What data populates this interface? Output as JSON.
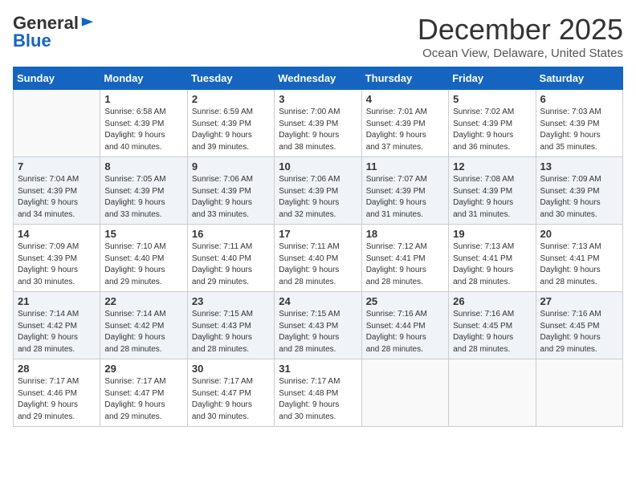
{
  "logo": {
    "general": "General",
    "blue": "Blue"
  },
  "title": "December 2025",
  "location": "Ocean View, Delaware, United States",
  "days_of_week": [
    "Sunday",
    "Monday",
    "Tuesday",
    "Wednesday",
    "Thursday",
    "Friday",
    "Saturday"
  ],
  "weeks": [
    [
      {
        "day": "",
        "info": ""
      },
      {
        "day": "1",
        "info": "Sunrise: 6:58 AM\nSunset: 4:39 PM\nDaylight: 9 hours\nand 40 minutes."
      },
      {
        "day": "2",
        "info": "Sunrise: 6:59 AM\nSunset: 4:39 PM\nDaylight: 9 hours\nand 39 minutes."
      },
      {
        "day": "3",
        "info": "Sunrise: 7:00 AM\nSunset: 4:39 PM\nDaylight: 9 hours\nand 38 minutes."
      },
      {
        "day": "4",
        "info": "Sunrise: 7:01 AM\nSunset: 4:39 PM\nDaylight: 9 hours\nand 37 minutes."
      },
      {
        "day": "5",
        "info": "Sunrise: 7:02 AM\nSunset: 4:39 PM\nDaylight: 9 hours\nand 36 minutes."
      },
      {
        "day": "6",
        "info": "Sunrise: 7:03 AM\nSunset: 4:39 PM\nDaylight: 9 hours\nand 35 minutes."
      }
    ],
    [
      {
        "day": "7",
        "info": "Sunrise: 7:04 AM\nSunset: 4:39 PM\nDaylight: 9 hours\nand 34 minutes."
      },
      {
        "day": "8",
        "info": "Sunrise: 7:05 AM\nSunset: 4:39 PM\nDaylight: 9 hours\nand 33 minutes."
      },
      {
        "day": "9",
        "info": "Sunrise: 7:06 AM\nSunset: 4:39 PM\nDaylight: 9 hours\nand 33 minutes."
      },
      {
        "day": "10",
        "info": "Sunrise: 7:06 AM\nSunset: 4:39 PM\nDaylight: 9 hours\nand 32 minutes."
      },
      {
        "day": "11",
        "info": "Sunrise: 7:07 AM\nSunset: 4:39 PM\nDaylight: 9 hours\nand 31 minutes."
      },
      {
        "day": "12",
        "info": "Sunrise: 7:08 AM\nSunset: 4:39 PM\nDaylight: 9 hours\nand 31 minutes."
      },
      {
        "day": "13",
        "info": "Sunrise: 7:09 AM\nSunset: 4:39 PM\nDaylight: 9 hours\nand 30 minutes."
      }
    ],
    [
      {
        "day": "14",
        "info": "Sunrise: 7:09 AM\nSunset: 4:39 PM\nDaylight: 9 hours\nand 30 minutes."
      },
      {
        "day": "15",
        "info": "Sunrise: 7:10 AM\nSunset: 4:40 PM\nDaylight: 9 hours\nand 29 minutes."
      },
      {
        "day": "16",
        "info": "Sunrise: 7:11 AM\nSunset: 4:40 PM\nDaylight: 9 hours\nand 29 minutes."
      },
      {
        "day": "17",
        "info": "Sunrise: 7:11 AM\nSunset: 4:40 PM\nDaylight: 9 hours\nand 28 minutes."
      },
      {
        "day": "18",
        "info": "Sunrise: 7:12 AM\nSunset: 4:41 PM\nDaylight: 9 hours\nand 28 minutes."
      },
      {
        "day": "19",
        "info": "Sunrise: 7:13 AM\nSunset: 4:41 PM\nDaylight: 9 hours\nand 28 minutes."
      },
      {
        "day": "20",
        "info": "Sunrise: 7:13 AM\nSunset: 4:41 PM\nDaylight: 9 hours\nand 28 minutes."
      }
    ],
    [
      {
        "day": "21",
        "info": "Sunrise: 7:14 AM\nSunset: 4:42 PM\nDaylight: 9 hours\nand 28 minutes."
      },
      {
        "day": "22",
        "info": "Sunrise: 7:14 AM\nSunset: 4:42 PM\nDaylight: 9 hours\nand 28 minutes."
      },
      {
        "day": "23",
        "info": "Sunrise: 7:15 AM\nSunset: 4:43 PM\nDaylight: 9 hours\nand 28 minutes."
      },
      {
        "day": "24",
        "info": "Sunrise: 7:15 AM\nSunset: 4:43 PM\nDaylight: 9 hours\nand 28 minutes."
      },
      {
        "day": "25",
        "info": "Sunrise: 7:16 AM\nSunset: 4:44 PM\nDaylight: 9 hours\nand 28 minutes."
      },
      {
        "day": "26",
        "info": "Sunrise: 7:16 AM\nSunset: 4:45 PM\nDaylight: 9 hours\nand 28 minutes."
      },
      {
        "day": "27",
        "info": "Sunrise: 7:16 AM\nSunset: 4:45 PM\nDaylight: 9 hours\nand 29 minutes."
      }
    ],
    [
      {
        "day": "28",
        "info": "Sunrise: 7:17 AM\nSunset: 4:46 PM\nDaylight: 9 hours\nand 29 minutes."
      },
      {
        "day": "29",
        "info": "Sunrise: 7:17 AM\nSunset: 4:47 PM\nDaylight: 9 hours\nand 29 minutes."
      },
      {
        "day": "30",
        "info": "Sunrise: 7:17 AM\nSunset: 4:47 PM\nDaylight: 9 hours\nand 30 minutes."
      },
      {
        "day": "31",
        "info": "Sunrise: 7:17 AM\nSunset: 4:48 PM\nDaylight: 9 hours\nand 30 minutes."
      },
      {
        "day": "",
        "info": ""
      },
      {
        "day": "",
        "info": ""
      },
      {
        "day": "",
        "info": ""
      }
    ]
  ]
}
